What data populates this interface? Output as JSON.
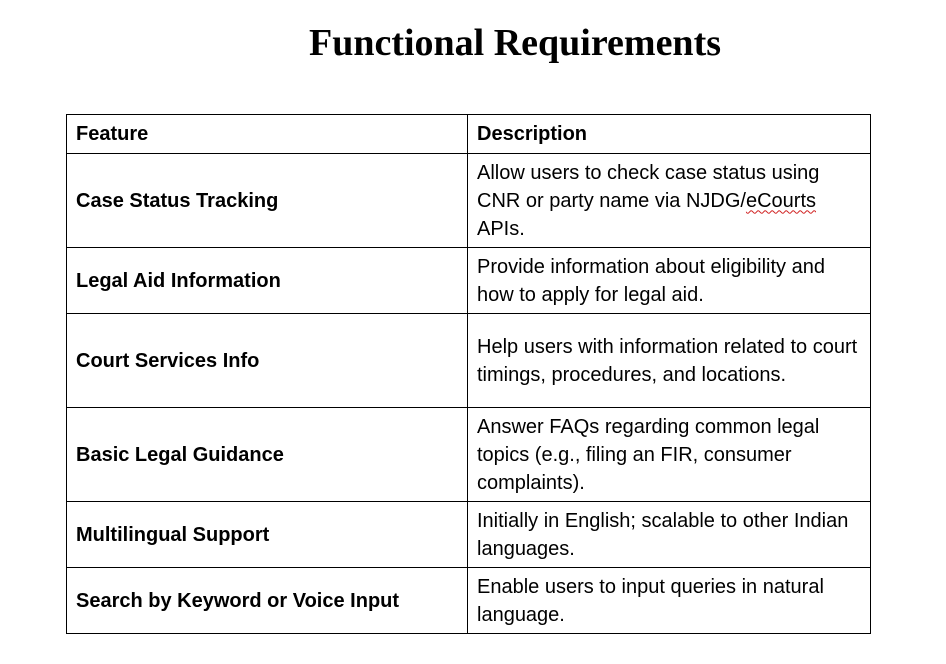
{
  "document": {
    "title": "Functional Requirements"
  },
  "table": {
    "headers": {
      "feature": "Feature",
      "description": "Description"
    },
    "rows": [
      {
        "feature": "Case Status Tracking",
        "description_pre": "Allow users to check case status using CNR or party name via NJDG/",
        "description_flagged": "eCourts",
        "description_post": " APIs."
      },
      {
        "feature": "Legal Aid Information",
        "description": "Provide information about eligibility and how to apply for legal aid."
      },
      {
        "feature": "Court Services Info",
        "description": "Help users with information related to court timings, procedures, and locations."
      },
      {
        "feature": "Basic Legal Guidance",
        "description": "Answer FAQs regarding common legal topics (e.g., filing an FIR, consumer complaints)."
      },
      {
        "feature": "Multilingual Support",
        "description": "Initially in English; scalable to other Indian languages."
      },
      {
        "feature": "Search by Keyword or Voice Input",
        "description": "Enable users to input queries in natural language."
      }
    ]
  }
}
